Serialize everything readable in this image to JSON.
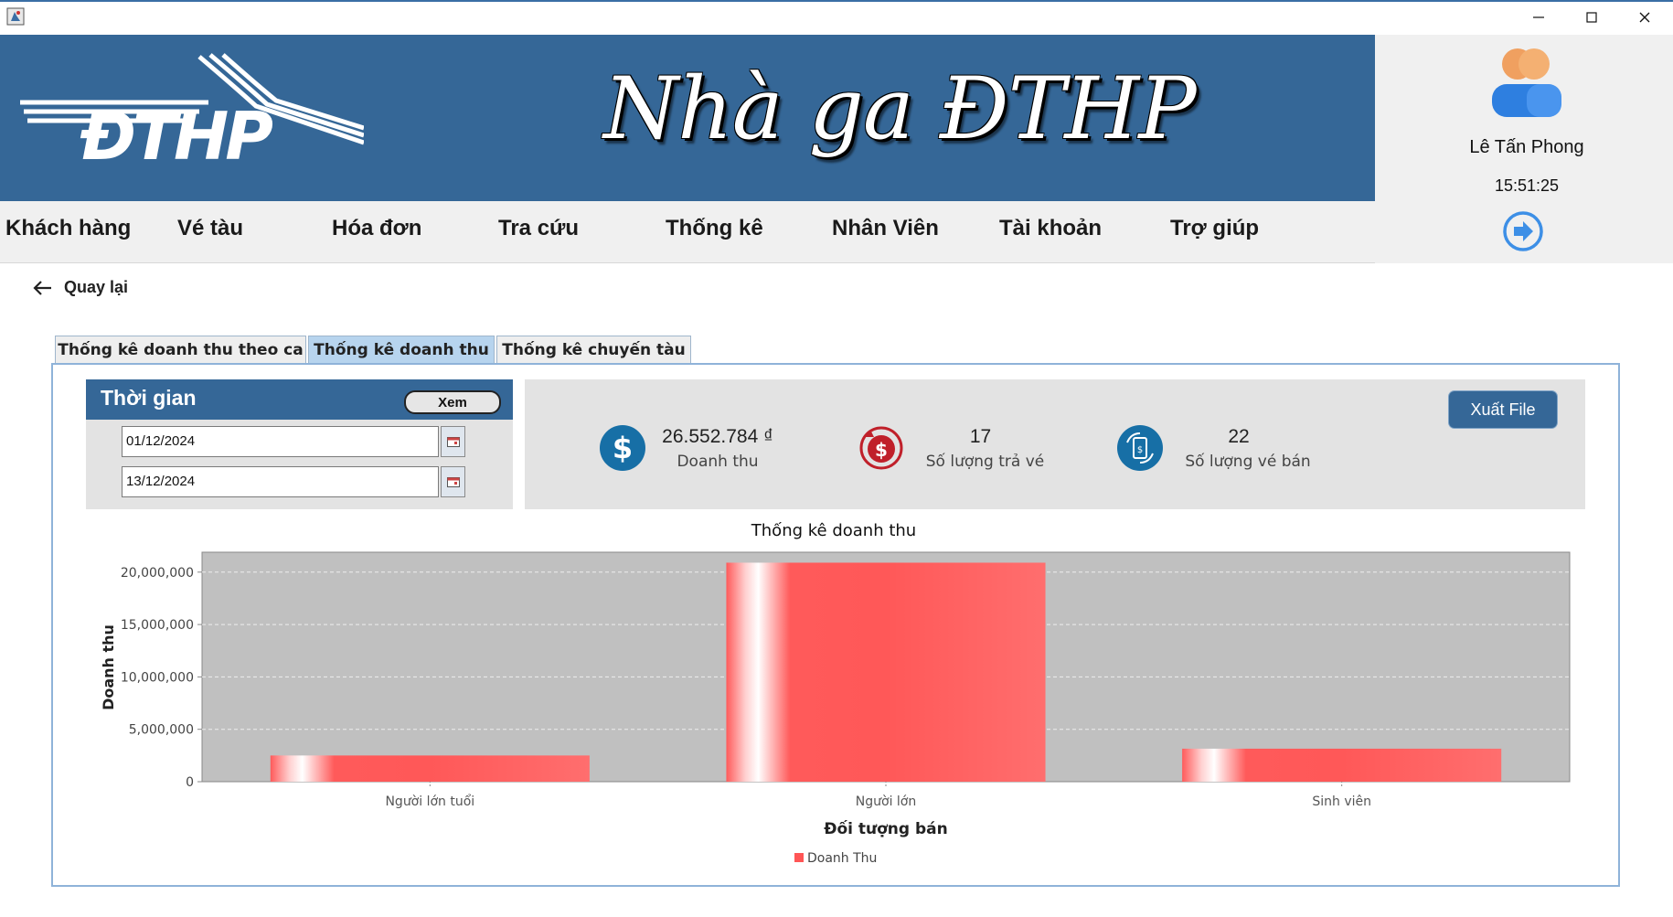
{
  "window": {
    "icons": {
      "app": "java-app-icon",
      "minimize": "minimize-icon",
      "maximize": "maximize-icon",
      "close": "close-icon"
    }
  },
  "banner": {
    "logo_text": "ĐTHP",
    "title": "Nhà ga ĐTHP",
    "background": "#356797"
  },
  "user": {
    "name": "Lê Tấn Phong",
    "clock": "15:51:25"
  },
  "menu": {
    "items": [
      "Khách hàng",
      "Vé tàu",
      "Hóa đơn",
      "Tra cứu",
      "Thống kê",
      "Nhân Viên",
      "Tài khoản",
      "Trợ giúp"
    ]
  },
  "back": {
    "label": "Quay lại"
  },
  "tabs": {
    "items": [
      "Thống kê doanh thu theo ca",
      "Thống kê doanh thu",
      "Thống kê chuyến tàu"
    ],
    "active_index": 1
  },
  "time_panel": {
    "title": "Thời gian",
    "view_button": "Xem",
    "from_date": "01/12/2024",
    "to_date": "13/12/2024"
  },
  "stats": {
    "revenue": {
      "value": "26.552.784 ₫",
      "label": "Doanh thu",
      "icon": "dollar-icon"
    },
    "returns": {
      "value": "17",
      "label": "Số lượng trả vé",
      "icon": "refund-icon"
    },
    "sold": {
      "value": "22",
      "label": "Số lượng vé bán",
      "icon": "ticket-exchange-icon"
    },
    "export_button": "Xuất File"
  },
  "chart_data": {
    "type": "bar",
    "title": "Thống kê doanh thu",
    "xlabel": "Đối tượng bán",
    "ylabel": "Doanh thu",
    "categories": [
      "Người lớn tuổi",
      "Người lớn",
      "Sinh viên"
    ],
    "series": [
      {
        "name": "Doanh Thu",
        "values": [
          2500000,
          20900000,
          3150000
        ],
        "color": "#ff5555"
      }
    ],
    "ylim": [
      0,
      21900000
    ],
    "yticks": [
      0,
      5000000,
      10000000,
      15000000,
      20000000
    ],
    "ytick_labels": [
      "0",
      "5,000,000",
      "10,000,000",
      "15,000,000",
      "20,000,000"
    ],
    "plot_background": "#c0c0c0",
    "grid": true,
    "legend": "bottom-center"
  }
}
